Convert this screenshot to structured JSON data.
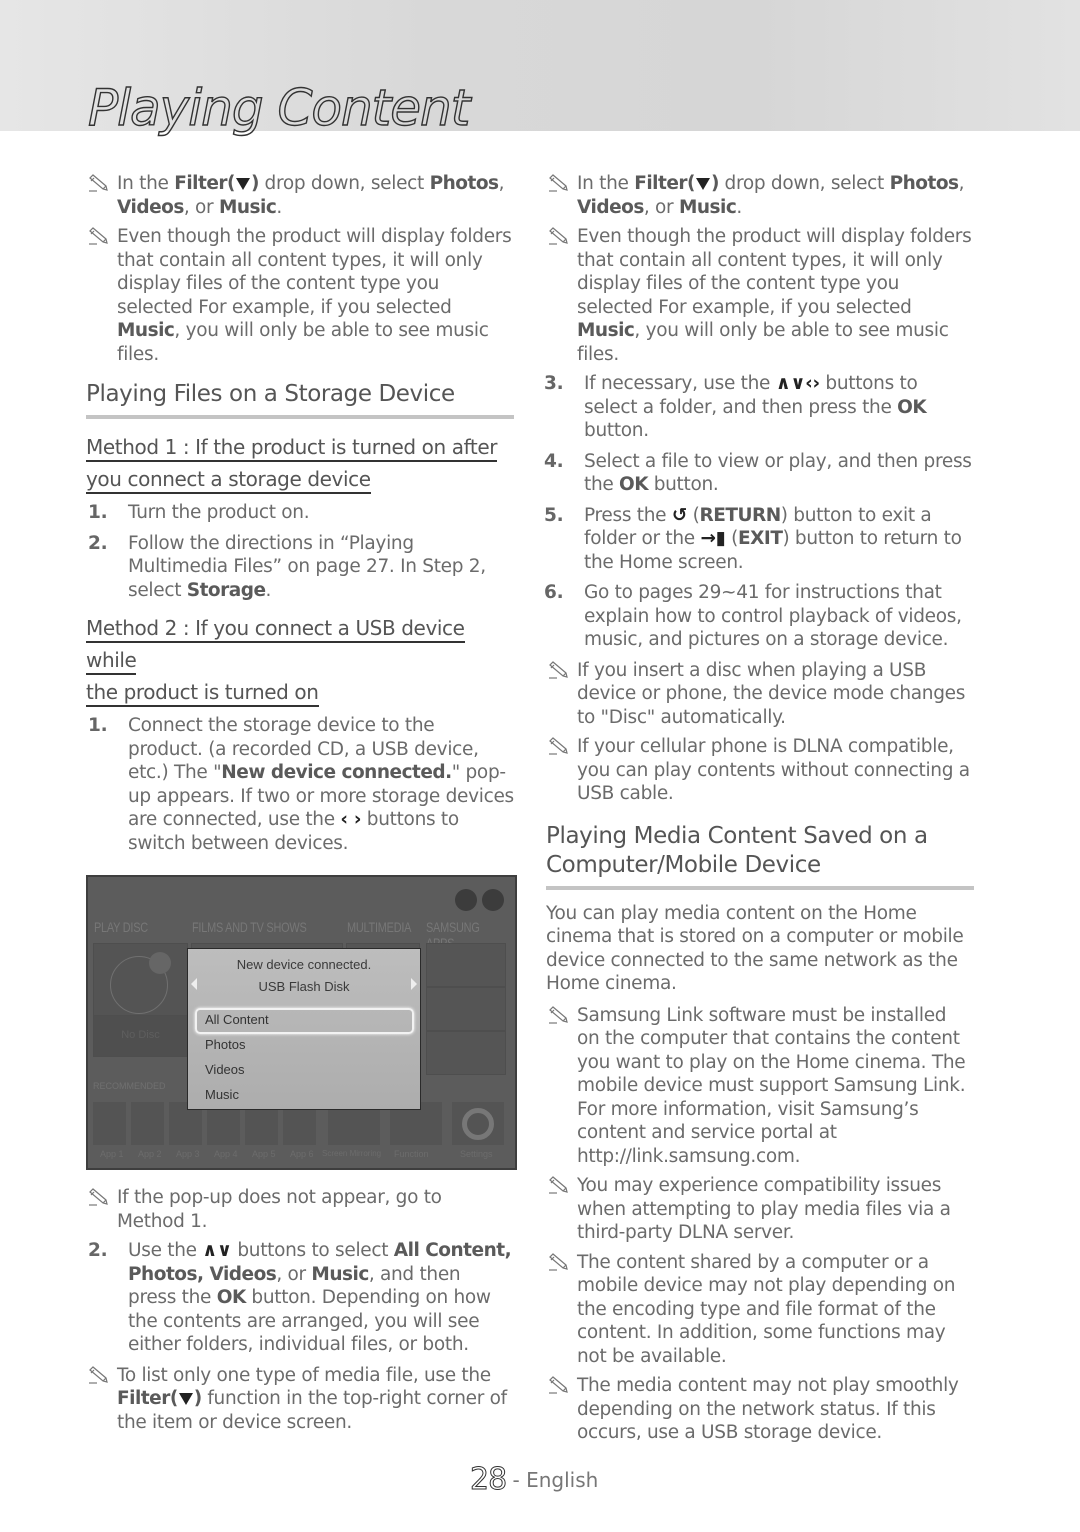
{
  "header": {
    "title": "Playing Content"
  },
  "left": {
    "notes_top": [
      {
        "parts": [
          [
            "In the ",
            false
          ],
          [
            "Filter(",
            true
          ],
          [
            "FILTER",
            "icon"
          ],
          [
            ")",
            true
          ],
          [
            " drop down, select ",
            false
          ],
          [
            "Photos",
            true
          ],
          [
            ", ",
            false
          ],
          [
            "Videos",
            true
          ],
          [
            ", or ",
            false
          ],
          [
            "Music",
            true
          ],
          [
            ".",
            false
          ]
        ]
      },
      {
        "parts": [
          [
            "Even though the product will display folders that contain all content types, it will only display files of the content type you selected For example, if you selected ",
            false
          ],
          [
            "Music",
            true
          ],
          [
            ", you will only be able to see music files.",
            false
          ]
        ]
      }
    ],
    "section_title": "Playing Files on a Storage Device",
    "method1": {
      "title_line1": "Method 1 : If the product is turned on after",
      "title_line2": "you connect a storage device",
      "steps": [
        {
          "num": "1.",
          "parts": [
            [
              "Turn the product on.",
              false
            ]
          ]
        },
        {
          "num": "2.",
          "parts": [
            [
              "Follow the directions in “Playing Multimedia Files” on page 27. In Step 2, select ",
              false
            ],
            [
              "Storage",
              true
            ],
            [
              ".",
              false
            ]
          ]
        }
      ]
    },
    "method2": {
      "title_line1": "Method 2 : If you connect a USB device while",
      "title_line2": "the product is turned on",
      "steps": [
        {
          "num": "1.",
          "parts": [
            [
              "Connect the storage device to the product. (a recorded CD, a USB device, etc.) The \"",
              false
            ],
            [
              "New device connected.",
              true
            ],
            [
              "\" pop-up appears. If two or more storage devices are connected, use the ",
              false
            ],
            [
              "‹ ›",
              "arrow"
            ],
            [
              " buttons to switch between devices.",
              false
            ]
          ]
        }
      ]
    },
    "tv_screen": {
      "categories": [
        "PLAY DISC",
        "FILMS AND TV SHOWS",
        "MULTIMEDIA",
        "SAMSUNG APPS"
      ],
      "disc_label": "No Disc",
      "recommended_label": "RECOMMENDED",
      "popup": {
        "title": "New device connected.",
        "device": "USB Flash Disk",
        "options": [
          "All Content",
          "Photos",
          "Videos",
          "Music"
        ],
        "selected": "All Content"
      },
      "apps": [
        "App 1",
        "App 2",
        "App 3",
        "App 4",
        "App 5",
        "App 6"
      ],
      "shortcuts": [
        "Screen Mirroring",
        "Function",
        "Settings"
      ]
    },
    "note_popup": {
      "parts": [
        [
          "If the pop-up does not appear, go to Method 1.",
          false
        ]
      ]
    },
    "step2": {
      "num": "2.",
      "parts": [
        [
          "Use the ",
          false
        ],
        [
          "∧∨",
          "arrow"
        ],
        [
          " buttons to select ",
          false
        ],
        [
          "All Content, Photos, Videos",
          true
        ],
        [
          ", or ",
          false
        ],
        [
          "Music",
          true
        ],
        [
          ", and then press the ",
          false
        ],
        [
          "OK",
          true
        ],
        [
          " button. Depending on how the contents are arranged, you will see either folders, individual files, or both.",
          false
        ]
      ]
    },
    "note_filter": {
      "parts": [
        [
          "To list only one type of media file, use the ",
          false
        ],
        [
          "Filter(",
          true
        ],
        [
          "FILTER",
          "icon"
        ],
        [
          ")",
          true
        ],
        [
          " function in the top-right corner of the item or device screen.",
          false
        ]
      ]
    }
  },
  "right": {
    "notes_top": [
      {
        "parts": [
          [
            "In the ",
            false
          ],
          [
            "Filter(",
            true
          ],
          [
            "FILTER",
            "icon"
          ],
          [
            ")",
            true
          ],
          [
            " drop down, select ",
            false
          ],
          [
            "Photos",
            true
          ],
          [
            ", ",
            false
          ],
          [
            "Videos",
            true
          ],
          [
            ", or ",
            false
          ],
          [
            "Music",
            true
          ],
          [
            ".",
            false
          ]
        ]
      },
      {
        "parts": [
          [
            "Even though the product will display folders that contain all content types, it will only display files of the content type you selected For example, if you selected ",
            false
          ],
          [
            "Music",
            true
          ],
          [
            ", you will only be able to see music files.",
            false
          ]
        ]
      }
    ],
    "steps": [
      {
        "num": "3.",
        "parts": [
          [
            "If necessary, use the ",
            false
          ],
          [
            "∧∨‹›",
            "arrow"
          ],
          [
            " buttons to select a folder, and then press the ",
            false
          ],
          [
            "OK",
            true
          ],
          [
            " button.",
            false
          ]
        ]
      },
      {
        "num": "4.",
        "parts": [
          [
            "Select a file to view or play, and then press the ",
            false
          ],
          [
            "OK",
            true
          ],
          [
            " button.",
            false
          ]
        ]
      },
      {
        "num": "5.",
        "parts": [
          [
            "Press the ",
            false
          ],
          [
            "↺",
            "arrow"
          ],
          [
            " (",
            false
          ],
          [
            "RETURN",
            true
          ],
          [
            ") button to exit a folder or the ",
            false
          ],
          [
            "→▮",
            "arrow"
          ],
          [
            " (",
            false
          ],
          [
            "EXIT",
            true
          ],
          [
            ") button to return to the Home screen.",
            false
          ]
        ]
      },
      {
        "num": "6.",
        "parts": [
          [
            "Go to pages 29~41 for instructions that explain how to control playback of videos, music, and pictures on a storage device.",
            false
          ]
        ]
      }
    ],
    "notes_mid": [
      {
        "parts": [
          [
            "If you insert a disc when playing a USB device or phone, the device mode changes to \"Disc\" automatically.",
            false
          ]
        ]
      },
      {
        "parts": [
          [
            "If your cellular phone is DLNA compatible, you can play contents without connecting a USB cable.",
            false
          ]
        ]
      }
    ],
    "section_title": "Playing Media Content Saved on a Computer/Mobile Device",
    "intro": "You can play media content on the Home cinema that is stored on a computer or mobile device connected to the same network as the Home cinema.",
    "notes_bottom": [
      {
        "parts": [
          [
            "Samsung Link software must be installed on the computer that contains the content you want to play on the Home cinema. The mobile device must support Samsung Link. For more information, visit Samsung’s content and service portal at http://link.samsung.com.",
            false
          ]
        ]
      },
      {
        "parts": [
          [
            "You may experience compatibility issues when attempting to play media files via a third-party DLNA server.",
            false
          ]
        ]
      },
      {
        "parts": [
          [
            "The content shared by a computer or a mobile device may not play depending on the encoding type and file format of the content. In addition, some functions may not be available.",
            false
          ]
        ]
      },
      {
        "parts": [
          [
            "The media content may not play smoothly depending on the network status. If this occurs, use a USB storage device.",
            false
          ]
        ]
      }
    ]
  },
  "footer": {
    "page": "28",
    "language": "- English"
  }
}
